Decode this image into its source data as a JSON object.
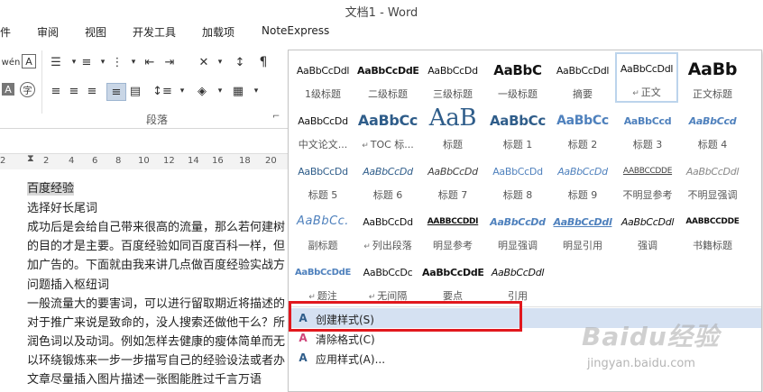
{
  "window": {
    "title": "文档1 - Word"
  },
  "tabs": [
    "件",
    "审阅",
    "视图",
    "开发工具",
    "加载项",
    "NoteExpress"
  ],
  "ribbon": {
    "group_label": "段落",
    "launcher_glyph": "⌐"
  },
  "ruler": {
    "ticks": [
      "2",
      "2",
      "4",
      "6",
      "8",
      "10",
      "12",
      "14",
      "16",
      "18",
      "20"
    ]
  },
  "document": {
    "lines": [
      "百度经验",
      "选择好长尾词",
      "成功后是会给自己带来很高的流量，那么若何建树",
      "的目的才是主要。百度经验如同百度百科一样，但",
      "加广告的。下面就由我来讲几点做百度经验实战方",
      "问题插入枢纽词",
      "一般流量大的要害词，可以进行留取期近将描述的",
      "对于推广来说是致命的，没人搜索还做他干么？所",
      "润色词以及动词。例如怎样去健康的瘦体简单而无",
      "以环绕锻炼来一步一步描写自己的经验设法或者办",
      "文章尽量插入图片描述一张图能胜过千言万语"
    ]
  },
  "style_gallery": {
    "styles": [
      {
        "preview": "AaBbCcDdl",
        "label": "1级标题"
      },
      {
        "preview": "AaBbCcDdE",
        "label": "二级标题"
      },
      {
        "preview": "AaBbCcDd",
        "label": "三级标题"
      },
      {
        "preview": "AaBbC",
        "label": "一级标题"
      },
      {
        "preview": "AaBbCcDdl",
        "label": "摘要"
      },
      {
        "preview": "AaBbCcDdl",
        "label": "正文",
        "mark": "↵"
      },
      {
        "preview": "AaBb",
        "label": "正文标题"
      },
      {
        "preview": "AaBbCcDd",
        "label": "中文论文..."
      },
      {
        "preview": "AaBbCc",
        "label": "TOC 标...",
        "mark": "↵"
      },
      {
        "preview": "AaB",
        "label": "标题"
      },
      {
        "preview": "AaBbCc",
        "label": "标题 1"
      },
      {
        "preview": "AaBbCc",
        "label": "标题 2"
      },
      {
        "preview": "AaBbCcd",
        "label": "标题 3"
      },
      {
        "preview": "AaBbCcd",
        "label": "标题 4"
      },
      {
        "preview": "AaBbCcDd",
        "label": "标题 5"
      },
      {
        "preview": "AaBbCcDd",
        "label": "标题 6"
      },
      {
        "preview": "AaBbCcDd",
        "label": "标题 7"
      },
      {
        "preview": "AaBbCcDd",
        "label": "标题 8"
      },
      {
        "preview": "AaBbCcDd",
        "label": "标题 9"
      },
      {
        "preview": "AABBCCDDE",
        "label": "不明显参考"
      },
      {
        "preview": "AaBbCcDdl",
        "label": "不明显强调"
      },
      {
        "preview": "AaBbCc.",
        "label": "副标题"
      },
      {
        "preview": "AaBbCcDd",
        "label": "列出段落",
        "mark": "↵"
      },
      {
        "preview": "AABBCCDDI",
        "label": "明显参考"
      },
      {
        "preview": "AaBbCcDd",
        "label": "明显强调"
      },
      {
        "preview": "AaBbCcDdl",
        "label": "明显引用"
      },
      {
        "preview": "AaBbCcDdl",
        "label": "强调"
      },
      {
        "preview": "AABBCCDDE",
        "label": "书籍标题"
      },
      {
        "preview": "AaBbCcDdE",
        "label": "题注",
        "mark": "↵"
      },
      {
        "preview": "AaBbCcDc",
        "label": "无间隔",
        "mark": "↵"
      },
      {
        "preview": "AaBbCcDdE",
        "label": "要点"
      },
      {
        "preview": "AaBbCcDdl",
        "label": "引用"
      }
    ],
    "menu": [
      {
        "label": "创建样式(S)",
        "icon": "create-style-icon"
      },
      {
        "label": "清除格式(C)",
        "icon": "clear-formatting-icon"
      },
      {
        "label": "应用样式(A)...",
        "icon": "apply-styles-icon"
      }
    ]
  },
  "watermark": {
    "text": "Baidu经验",
    "url": "jingyan.baidu.com"
  }
}
